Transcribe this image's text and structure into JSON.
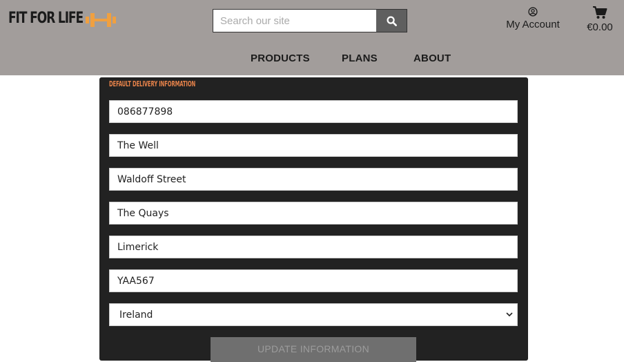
{
  "header": {
    "logo_text": "FIT FOR LIFE",
    "search": {
      "placeholder": "Search our site",
      "value": ""
    },
    "account_label": "My Account",
    "cart_total": "€0.00",
    "nav": [
      "PRODUCTS",
      "PLANS",
      "ABOUT"
    ],
    "colors": {
      "background": "#a29d9b",
      "logo_accent": "#f0a040"
    }
  },
  "form": {
    "title": "DEFAULT DELIVERY INFORMATION",
    "fields": {
      "phone": "086877898",
      "address1": "The Well",
      "address2": "Waldoff Street",
      "town": "The Quays",
      "county": "Limerick",
      "postcode": "YAA567"
    },
    "country": "Ireland",
    "button_label": "UPDATE INFORMATION",
    "colors": {
      "panel": "#222222",
      "title": "#e8834a"
    }
  },
  "icons": {
    "search": "search-icon",
    "account": "user-circle-icon",
    "cart": "shopping-cart-icon",
    "logo": "dumbbell-icon",
    "select": "chevron-down-icon"
  }
}
